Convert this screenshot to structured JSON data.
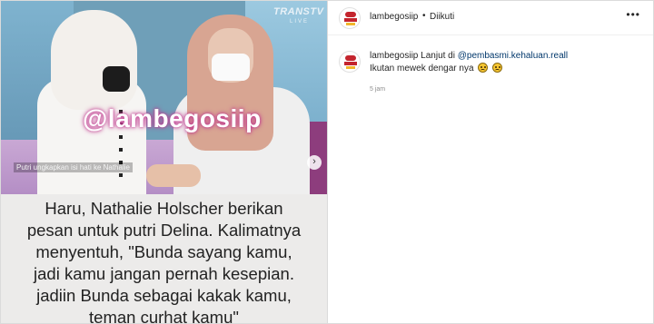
{
  "video": {
    "channel": "TRANSTV",
    "channel_sub": "LIVE",
    "watermark": "@lambegosiip",
    "subtitle": "Putri ungkapkan isi hati ke Nathalie",
    "next_icon": "chevron-right-icon"
  },
  "caption": {
    "lines": [
      "Haru, Nathalie Holscher berikan",
      "pesan untuk putri Delina. Kalimatnya",
      "menyentuh, \"Bunda sayang kamu,",
      "jadi kamu jangan pernah kesepian.",
      "jadiin Bunda sebagai kakak kamu,",
      "teman curhat kamu\""
    ]
  },
  "header": {
    "username": "lambegosiip",
    "separator": "•",
    "follow_status": "Diikuti",
    "more_icon": "more-horizontal-icon"
  },
  "comment": {
    "username": "lambegosiip",
    "text_before": "Lanjut di",
    "mention": "@pembasmi.kehaluan.reall",
    "line2": "Ikutan mewek dengar nya",
    "emoji_count": 2,
    "time": "5 jam"
  },
  "colors": {
    "mention": "#00376b",
    "watermark_glow": "#c0398f",
    "muted": "#8e8e8e"
  }
}
